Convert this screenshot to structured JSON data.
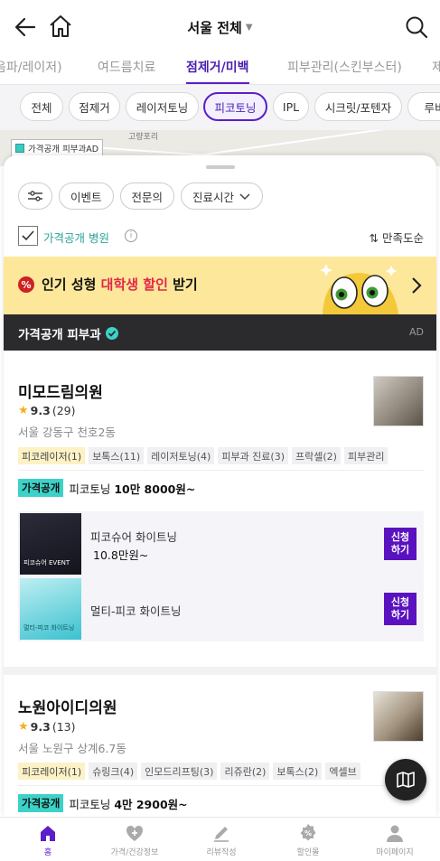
{
  "header": {
    "title": "서울 전체"
  },
  "category_tabs": [
    {
      "label": "음파/레이저)"
    },
    {
      "label": "여드름치료"
    },
    {
      "label": "점제거/미백"
    },
    {
      "label": "피부관리(스킨부스터)"
    },
    {
      "label": "제"
    }
  ],
  "chips": [
    {
      "label": "전체"
    },
    {
      "label": "점제거"
    },
    {
      "label": "레이저토닝"
    },
    {
      "label": "피코토닝"
    },
    {
      "label": "IPL"
    },
    {
      "label": "시크릿/포텐자"
    },
    {
      "label": "루비"
    }
  ],
  "map": {
    "legend": "가격공개 피부과AD",
    "place": "고량포리"
  },
  "filters": {
    "event": "이벤트",
    "specialist": "전문의",
    "hours": "진료시간"
  },
  "options": {
    "price_open": "가격공개 병원",
    "sort": "만족도순"
  },
  "promo": {
    "prefix": "인기 성형 ",
    "highlight": "대학생 할인",
    "suffix": " 받기",
    "pct": "%"
  },
  "ad_section": {
    "title": "가격공개 피부과",
    "ad": "AD"
  },
  "clinics": [
    {
      "name": "미모드림의원",
      "rating": "9.3",
      "reviews": "(29)",
      "address": "서울 강동구 천호2동",
      "tags": [
        "피코레이저(1)",
        "보톡스(11)",
        "레이저토닝(4)",
        "피부과 진료(3)",
        "프락셀(2)",
        "피부관리"
      ],
      "price_badge": "가격공개",
      "price_text": "피코토닝 ",
      "price_value": "10만 8000원~",
      "events": [
        {
          "name": "피코슈어 화이트닝",
          "price": "10.8만원~",
          "image_caption": "피코슈어 EVENT",
          "apply": "신청\n하기"
        },
        {
          "name": "멀티-피코 화이트닝",
          "price": "",
          "image_caption": "멀티-피코 화이트닝",
          "apply": "신청\n하기"
        }
      ]
    },
    {
      "name": "노원아이디의원",
      "rating": "9.3",
      "reviews": "(13)",
      "address": "서울 노원구 상계6.7동",
      "tags": [
        "피코레이저(1)",
        "슈링크(4)",
        "인모드리프팅(3)",
        "리쥬란(2)",
        "보톡스(2)",
        "엑셀브"
      ],
      "price_badge": "가격공개",
      "price_text": "피코토닝 ",
      "price_value": "4만 2900원~"
    }
  ],
  "bottom_nav": [
    {
      "label": "홈",
      "icon": "home-icon"
    },
    {
      "label": "가격/건강정보",
      "icon": "heart-plus-icon"
    },
    {
      "label": "리뷰작성",
      "icon": "pencil-icon"
    },
    {
      "label": "할인몰",
      "icon": "discount-icon"
    },
    {
      "label": "마이페이지",
      "icon": "person-icon"
    }
  ],
  "colors": {
    "accent": "#5a1fc8",
    "teal": "#3cd2c8",
    "promo_bg": "#fde79a",
    "discount_red": "#e0274a"
  }
}
